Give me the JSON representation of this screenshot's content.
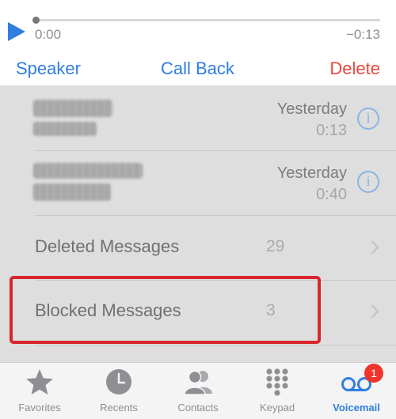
{
  "player": {
    "elapsed": "0:00",
    "remaining": "−0:13",
    "progress": 0
  },
  "actions": {
    "speaker": "Speaker",
    "call_back": "Call Back",
    "delete": "Delete"
  },
  "voicemails": [
    {
      "date": "Yesterday",
      "duration": "0:13"
    },
    {
      "date": "Yesterday",
      "duration": "0:40"
    }
  ],
  "folders": [
    {
      "label": "Deleted Messages",
      "count": "29"
    },
    {
      "label": "Blocked Messages",
      "count": "3"
    }
  ],
  "tabs": [
    {
      "label": "Favorites",
      "icon": "star-icon"
    },
    {
      "label": "Recents",
      "icon": "clock-icon"
    },
    {
      "label": "Contacts",
      "icon": "contacts-icon"
    },
    {
      "label": "Keypad",
      "icon": "keypad-icon"
    },
    {
      "label": "Voicemail",
      "icon": "voicemail-icon",
      "badge": "1",
      "active": true
    }
  ],
  "colors": {
    "accent": "#2f7ee0",
    "delete": "#f0463c",
    "highlight": "#d9262e",
    "badge": "#f0342c"
  }
}
